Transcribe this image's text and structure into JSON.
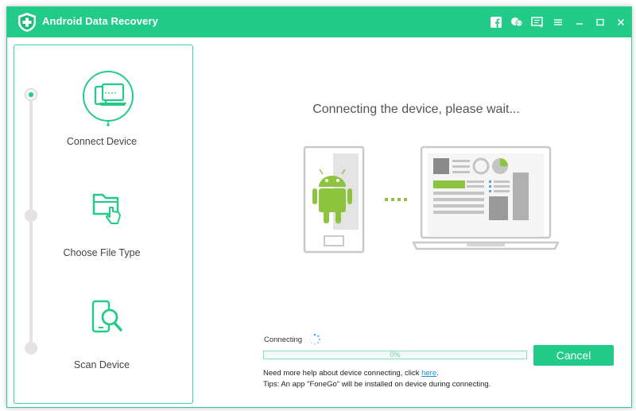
{
  "app": {
    "title": "Android Data Recovery"
  },
  "colors": {
    "accent": "#22cc88",
    "link": "#1a8fd6"
  },
  "titlebar": {
    "icons": [
      "facebook-icon",
      "chat-icon",
      "feedback-icon",
      "minimize-icon",
      "maximize-icon",
      "close-icon"
    ]
  },
  "sidebar": {
    "steps": [
      {
        "label": "Connect Device",
        "icon": "devices-icon",
        "active": true
      },
      {
        "label": "Choose File Type",
        "icon": "folder-touch-icon",
        "active": false
      },
      {
        "label": "Scan Device",
        "icon": "phone-search-icon",
        "active": false
      }
    ]
  },
  "main": {
    "title": "Connecting the device, please wait...",
    "status_label": "Connecting",
    "progress_text": "0%",
    "progress_fraction": 0,
    "cancel_label": "Cancel",
    "help_prefix": "Need more help about device connecting, click ",
    "help_link": "here",
    "help_suffix": ".",
    "tips": "Tips: An app \"FoneGo\" will be installed on device during connecting."
  }
}
